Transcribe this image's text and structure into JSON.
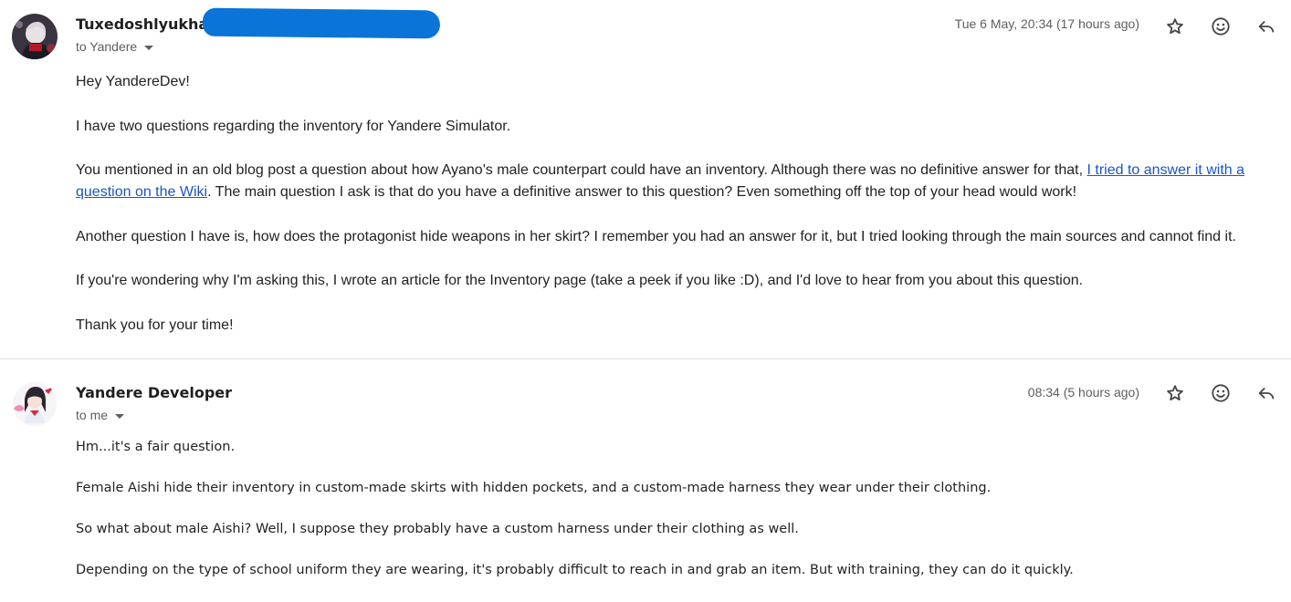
{
  "messages": [
    {
      "sender": "Tuxedoshlyukha",
      "to_label": "to Yandere",
      "date": "Tue 6 May, 20:34 (17 hours ago)",
      "body": {
        "p1": "Hey YandereDev!",
        "p2": "I have two questions regarding the inventory for Yandere Simulator.",
        "p3_before": "You mentioned in an old blog post a question about how Ayano's male counterpart could have an inventory. Although there was no definitive answer for that, ",
        "p3_link": "I tried to answer it with a question on the Wiki",
        "p3_after": ". The main question I ask is that do you have a definitive answer to this question? Even something off the top of your head would work!",
        "p4": "Another question I have is, how does the protagonist hide weapons in her skirt? I remember you had an answer for it, but I tried looking through the main sources and cannot find it.",
        "p5": "If you're wondering why I'm asking this, I wrote an article for the Inventory page (take a peek if you like :D), and I'd love to hear from you about this question.",
        "p6": "Thank you for your time!"
      }
    },
    {
      "sender": "Yandere Developer",
      "to_label": "to me",
      "date": "08:34 (5 hours ago)",
      "body": {
        "p1": "Hm...it's a fair question.",
        "p2": "Female Aishi hide their inventory in custom-made skirts with hidden pockets, and a custom-made harness they wear under their clothing.",
        "p3": "So what about male Aishi? Well, I suppose they probably have a custom harness under their clothing as well.",
        "p4": "Depending on the type of school uniform they are wearing, it's probably difficult to reach in and grab an item. But with training, they can do it quickly."
      }
    }
  ],
  "icons": [
    "star-icon",
    "emoji-icon",
    "reply-icon"
  ],
  "colors": {
    "link": "#1a56c4",
    "redaction": "#0a74d8",
    "meta_text": "#5e5e5e"
  }
}
